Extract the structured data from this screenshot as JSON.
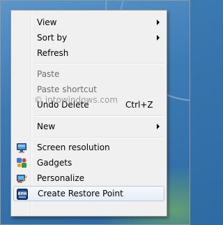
{
  "watermark": "© intowindows.com",
  "menu": {
    "view": "View",
    "sort_by": "Sort by",
    "refresh": "Refresh",
    "paste": "Paste",
    "paste_shortcut": "Paste shortcut",
    "undo_delete": "Undo Delete",
    "undo_delete_shortcut": "Ctrl+Z",
    "new": "New",
    "screen_resolution": "Screen resolution",
    "gadgets": "Gadgets",
    "personalize": "Personalize",
    "create_restore_point": "Create Restore Point"
  },
  "icons": {
    "screen_resolution": "monitor-icon",
    "gadgets": "gadgets-icon",
    "personalize": "personalize-icon",
    "create_restore_point": "restore-point-icon"
  },
  "colors": {
    "menu_bg": "#f0f0f0",
    "hover_border": "#b5cbe5",
    "disabled_text": "#6d6d6d"
  }
}
